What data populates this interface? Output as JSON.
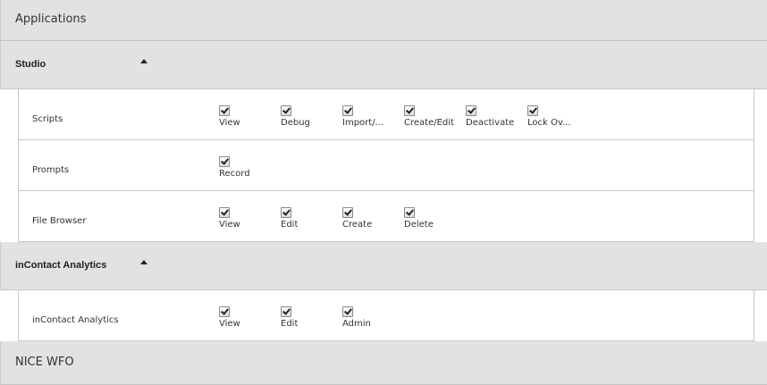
{
  "header": {
    "title": "Applications"
  },
  "sections": [
    {
      "title": "Studio",
      "rows": [
        {
          "label": "Scripts",
          "permissions": [
            {
              "label": "View",
              "checked": true
            },
            {
              "label": "Debug",
              "checked": true
            },
            {
              "label": "Import/...",
              "checked": true
            },
            {
              "label": "Create/Edit",
              "checked": true
            },
            {
              "label": "Deactivate",
              "checked": true
            },
            {
              "label": "Lock Ov...",
              "checked": true
            }
          ]
        },
        {
          "label": "Prompts",
          "permissions": [
            {
              "label": "Record",
              "checked": true
            }
          ]
        },
        {
          "label": "File Browser",
          "permissions": [
            {
              "label": "View",
              "checked": true
            },
            {
              "label": "Edit",
              "checked": true
            },
            {
              "label": "Create",
              "checked": true
            },
            {
              "label": "Delete",
              "checked": true
            }
          ]
        }
      ]
    },
    {
      "title": "inContact Analytics",
      "rows": [
        {
          "label": "inContact Analytics",
          "permissions": [
            {
              "label": "View",
              "checked": true
            },
            {
              "label": "Edit",
              "checked": true
            },
            {
              "label": "Admin",
              "checked": true
            }
          ]
        }
      ]
    }
  ],
  "footer_section": {
    "title": "NICE WFO"
  },
  "icons": {
    "collapse": "caret-up-icon",
    "checkbox": "checkmark-icon"
  }
}
